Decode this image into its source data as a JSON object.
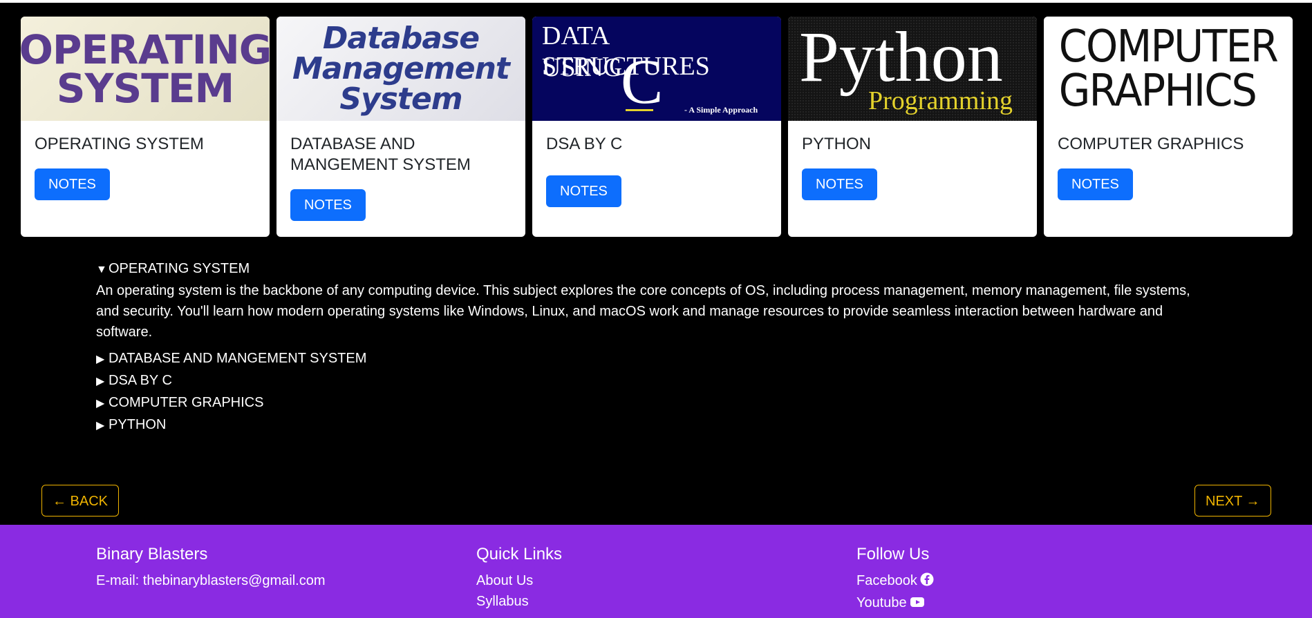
{
  "cards": [
    {
      "image_text": [
        "OPERATING",
        "SYSTEM"
      ],
      "title": "OPERATING SYSTEM",
      "button": "NOTES"
    },
    {
      "image_text": [
        "Database",
        "Management",
        "System"
      ],
      "title": "DATABASE AND MANGEMENT SYSTEM",
      "button": "NOTES"
    },
    {
      "image_text": [
        "DATA STRUCTURES",
        "USING",
        "C",
        "- A Simple Approach"
      ],
      "title": "DSA BY C",
      "button": "NOTES"
    },
    {
      "image_text": [
        "Python",
        "Programming"
      ],
      "title": "PYTHON",
      "button": "NOTES"
    },
    {
      "image_text": [
        "COMPUTER",
        "GRAPHICS"
      ],
      "title": "COMPUTER GRAPHICS",
      "button": "NOTES"
    }
  ],
  "accordion": {
    "open_marker": "▼",
    "closed_marker": "▶",
    "items": [
      {
        "label": "OPERATING SYSTEM",
        "open": true,
        "description": "An operating system is the backbone of any computing device. This subject explores the core concepts of OS, including process management, memory management, file systems, and security. You'll learn how modern operating systems like Windows, Linux, and macOS work and manage resources to provide seamless interaction between hardware and software."
      },
      {
        "label": "DATABASE AND MANGEMENT SYSTEM",
        "open": false
      },
      {
        "label": "DSA BY C",
        "open": false
      },
      {
        "label": "COMPUTER GRAPHICS",
        "open": false
      },
      {
        "label": "PYTHON",
        "open": false
      }
    ]
  },
  "nav": {
    "back": "← BACK",
    "next": "NEXT →"
  },
  "colors": {
    "accent": "#0d6efd",
    "nav_border": "#f0b400",
    "footer_bg": "#8a2be2"
  },
  "footer": {
    "brand": {
      "title": "Binary Blasters",
      "email": "E-mail: thebinaryblasters@gmail.com"
    },
    "quick_links": {
      "title": "Quick Links",
      "links": [
        "About Us",
        "Syllabus"
      ]
    },
    "follow": {
      "title": "Follow Us",
      "links": [
        {
          "label": "Facebook",
          "icon": "facebook-icon"
        },
        {
          "label": "Youtube",
          "icon": "youtube-icon"
        }
      ]
    }
  }
}
